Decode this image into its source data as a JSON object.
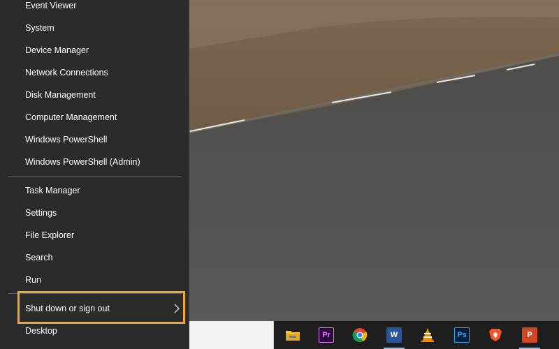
{
  "menu": {
    "items": [
      {
        "label": "Event Viewer"
      },
      {
        "label": "System"
      },
      {
        "label": "Device Manager"
      },
      {
        "label": "Network Connections"
      },
      {
        "label": "Disk Management"
      },
      {
        "label": "Computer Management"
      },
      {
        "label": "Windows PowerShell"
      },
      {
        "label": "Windows PowerShell (Admin)"
      }
    ],
    "items2": [
      {
        "label": "Task Manager"
      },
      {
        "label": "Settings"
      },
      {
        "label": "File Explorer"
      },
      {
        "label": "Search"
      },
      {
        "label": "Run"
      }
    ],
    "shutdown": {
      "label": "Shut down or sign out",
      "icon": "chevron-right-icon"
    },
    "desktop": {
      "label": "Desktop"
    },
    "highlight_color": "#f2a62e"
  },
  "taskbar": {
    "apps": [
      {
        "name": "file-explorer",
        "icon": "folder-icon",
        "glyph": "",
        "color": "#f4c542"
      },
      {
        "name": "premiere-pro",
        "icon": "premiere-pro-icon",
        "glyph": "Pr",
        "color": "#2a0a3a"
      },
      {
        "name": "chrome",
        "icon": "chrome-icon",
        "glyph": "",
        "color": "#db4437"
      },
      {
        "name": "word",
        "icon": "word-icon",
        "glyph": "W",
        "color": "#2b579a"
      },
      {
        "name": "vlc",
        "icon": "vlc-icon",
        "glyph": "",
        "color": "#f08a00"
      },
      {
        "name": "photoshop",
        "icon": "photoshop-icon",
        "glyph": "Ps",
        "color": "#001e36"
      },
      {
        "name": "brave",
        "icon": "brave-icon",
        "glyph": "",
        "color": "#fb542b"
      },
      {
        "name": "powerpoint",
        "icon": "powerpoint-icon",
        "glyph": "P",
        "color": "#d24726"
      }
    ]
  }
}
